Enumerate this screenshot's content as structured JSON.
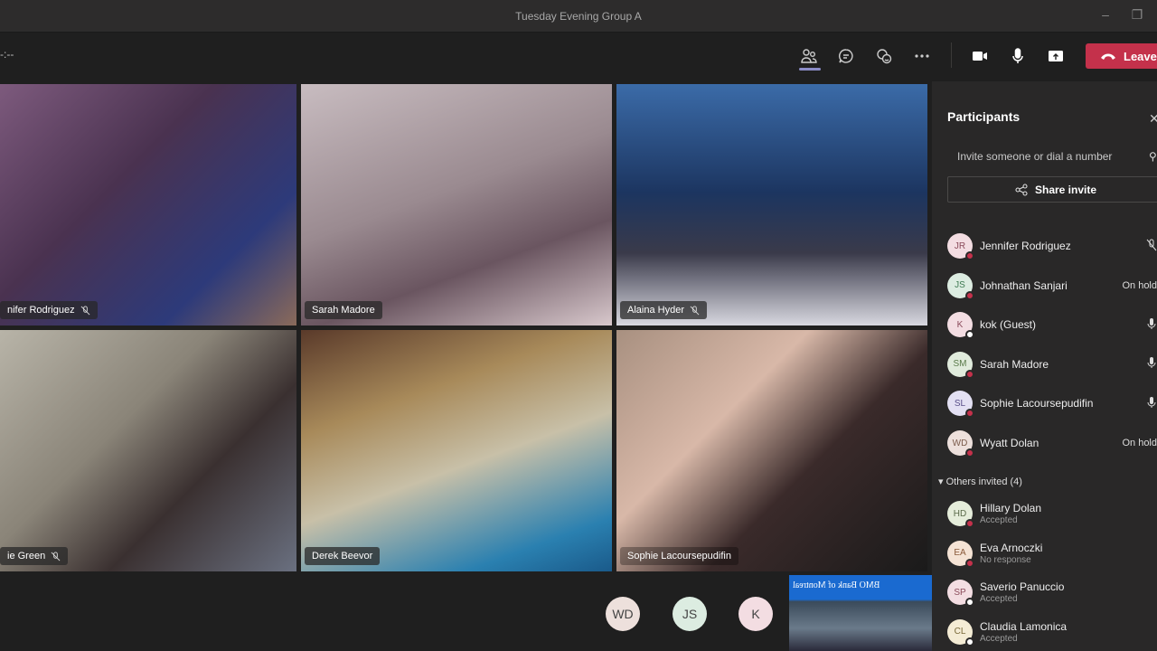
{
  "window": {
    "title": "Tuesday Evening Group A",
    "minimize_icon": "minimize-icon",
    "restore_icon": "restore-icon"
  },
  "toolbar": {
    "timer": "-:--",
    "buttons": [
      {
        "name": "participants",
        "icon": "people-icon",
        "active": true
      },
      {
        "name": "chat",
        "icon": "chat-icon"
      },
      {
        "name": "reactions",
        "icon": "raise-hand-icon"
      },
      {
        "name": "more",
        "icon": "more-icon"
      },
      {
        "name": "camera",
        "icon": "video-camera-icon"
      },
      {
        "name": "mic",
        "icon": "microphone-icon"
      },
      {
        "name": "share",
        "icon": "share-screen-icon"
      }
    ],
    "leave_label": "Leave",
    "leave_color": "#c4314b"
  },
  "stage": {
    "tiles": [
      {
        "name": "Jennifer Rodriguez",
        "label": "nifer Rodriguez",
        "muted": true
      },
      {
        "name": "Sarah Madore",
        "label": "Sarah Madore",
        "muted": false
      },
      {
        "name": "Alaina Hyder",
        "label": "Alaina Hyder",
        "muted": true
      },
      {
        "name": "Sophie Green",
        "label": "ie Green",
        "muted": true
      },
      {
        "name": "Derek Beevor",
        "label": "Derek Beevor",
        "muted": false
      },
      {
        "name": "Sophie Lacoursepudifin",
        "label": "Sophie Lacoursepudifin",
        "muted": false
      }
    ],
    "overflow_avatars": [
      {
        "initials": "WD",
        "color": "#ede0dc"
      },
      {
        "initials": "JS",
        "color": "#dcece1"
      },
      {
        "initials": "K",
        "color": "#f3dde2"
      }
    ],
    "self_view_sign": "BMO Bank of Montreal"
  },
  "panel": {
    "title": "Participants",
    "invite_placeholder": "Invite someone or dial a number",
    "share_invite_label": "Share invite",
    "participants": [
      {
        "initials": "JR",
        "name": "Jennifer Rodriguez",
        "status": "mic-off-icon",
        "avatar_color": "#f3dde2",
        "text_color": "#8a4a5a",
        "presence": "#c4314b"
      },
      {
        "initials": "JS",
        "name": "Johnathan Sanjari",
        "status_text": "On hold",
        "avatar_color": "#dcece1",
        "text_color": "#3f7a52",
        "presence": "#c4314b"
      },
      {
        "initials": "K",
        "name": "kok (Guest)",
        "status": "mic-icon",
        "avatar_color": "#f3dde2",
        "text_color": "#8a4a5a",
        "presence": "#ffffff"
      },
      {
        "initials": "SM",
        "name": "Sarah Madore",
        "status": "mic-icon",
        "avatar_color": "#e0ebdc",
        "text_color": "#5a7a4a",
        "presence": "#c4314b"
      },
      {
        "initials": "SL",
        "name": "Sophie Lacoursepudifin",
        "status": "mic-icon",
        "avatar_color": "#e3e0f3",
        "text_color": "#5a4f8a",
        "presence": "#c4314b"
      },
      {
        "initials": "WD",
        "name": "Wyatt Dolan",
        "status_text": "On hold",
        "avatar_color": "#ede0dc",
        "text_color": "#7a5a4a",
        "presence": "#c4314b"
      }
    ],
    "others_label": "Others invited (4)",
    "invited": [
      {
        "initials": "HD",
        "name": "Hillary Dolan",
        "sub": "Accepted",
        "avatar_color": "#e5edda",
        "text_color": "#5a6a4a",
        "presence": "#c4314b"
      },
      {
        "initials": "EA",
        "name": "Eva Arnoczki",
        "sub": "No response",
        "avatar_color": "#f5e3d5",
        "text_color": "#8a5a3a",
        "presence": "#c4314b"
      },
      {
        "initials": "SP",
        "name": "Saverio Panuccio",
        "sub": "Accepted",
        "avatar_color": "#f3dde2",
        "text_color": "#8a4a5a",
        "presence": "#ffffff"
      },
      {
        "initials": "CL",
        "name": "Claudia Lamonica",
        "sub": "Accepted",
        "avatar_color": "#f4ecd5",
        "text_color": "#7a6a3a",
        "presence": "#ffffff"
      }
    ]
  }
}
